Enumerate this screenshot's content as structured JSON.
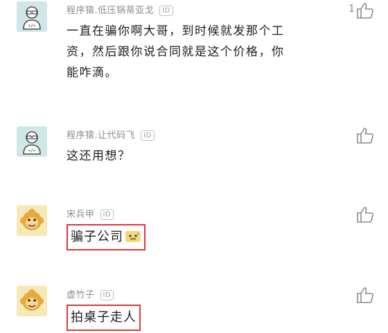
{
  "comments": [
    {
      "username": "程序猿.低压锅蒂亚戈",
      "id_badge": "ID",
      "lines": [
        "一直在骗你啊大哥，到时候就发那个工",
        "资，然后跟你说合同就是这个价格，你",
        "能咋滴。"
      ],
      "likes": "1",
      "avatar": "coder-avatar-icon"
    },
    {
      "username": "程序猿.让代码飞",
      "id_badge": "ID",
      "text": "这还用想？",
      "avatar": "coder-avatar-icon"
    },
    {
      "username": "宋兵甲",
      "id_badge": "ID",
      "text": "骗子公司",
      "emoji": "sweat-emoji",
      "avatar": "monkey-avatar-icon",
      "highlight_color": "#d9383b"
    },
    {
      "username": "虚竹子",
      "id_badge": "ID",
      "text": "拍桌子走人",
      "avatar": "monkey-avatar-icon",
      "highlight_color": "#d9383b"
    }
  ]
}
